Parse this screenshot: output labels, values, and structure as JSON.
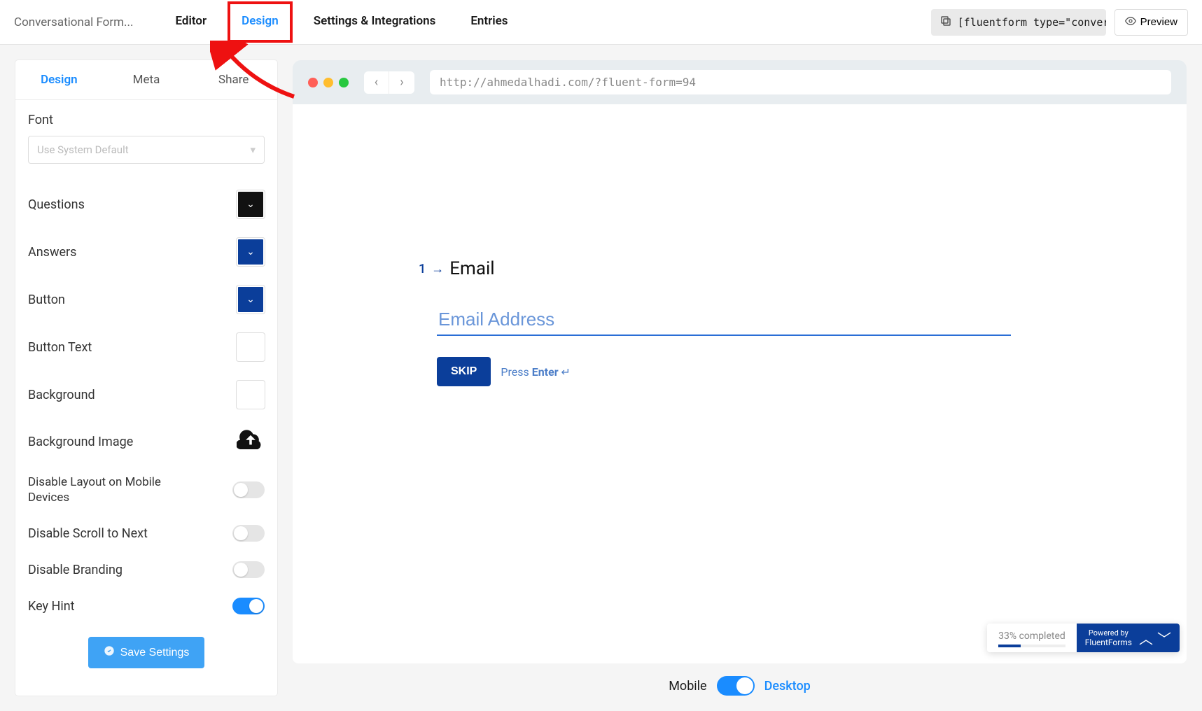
{
  "topbar": {
    "title": "Conversational Form...",
    "tabs": [
      "Editor",
      "Design",
      "Settings & Integrations",
      "Entries"
    ],
    "active_tab": "Design",
    "shortcode": "[fluentform type=\"convers",
    "preview_label": "Preview"
  },
  "sidebar": {
    "tabs": [
      "Design",
      "Meta",
      "Share"
    ],
    "active_tab": "Design",
    "font_label": "Font",
    "font_value": "Use System Default",
    "settings": {
      "questions_label": "Questions",
      "answers_label": "Answers",
      "button_label": "Button",
      "button_text_label": "Button Text",
      "background_label": "Background",
      "background_image_label": "Background Image",
      "disable_layout_label": "Disable Layout on Mobile Devices",
      "disable_scroll_label": "Disable Scroll to Next",
      "disable_branding_label": "Disable Branding",
      "key_hint_label": "Key Hint"
    },
    "colors": {
      "questions": "#111111",
      "answers": "#0b3e9a",
      "button": "#0b3e9a",
      "button_text": "#ffffff",
      "background": "#ffffff"
    },
    "toggles": {
      "disable_layout": false,
      "disable_scroll": false,
      "disable_branding": false,
      "key_hint": true
    },
    "save_label": "Save Settings"
  },
  "preview": {
    "url": "http://ahmedalhadi.com/?fluent-form=94",
    "question_number": "1",
    "question_label": "Email",
    "placeholder": "Email Address",
    "skip_label": "SKIP",
    "press_text": "Press ",
    "enter_text": "Enter",
    "enter_glyph": " ↵",
    "progress_text": "33% completed",
    "powered_by_small": "Powered by",
    "powered_by_brand": "FluentForms"
  },
  "device_toggle": {
    "mobile_label": "Mobile",
    "desktop_label": "Desktop"
  }
}
